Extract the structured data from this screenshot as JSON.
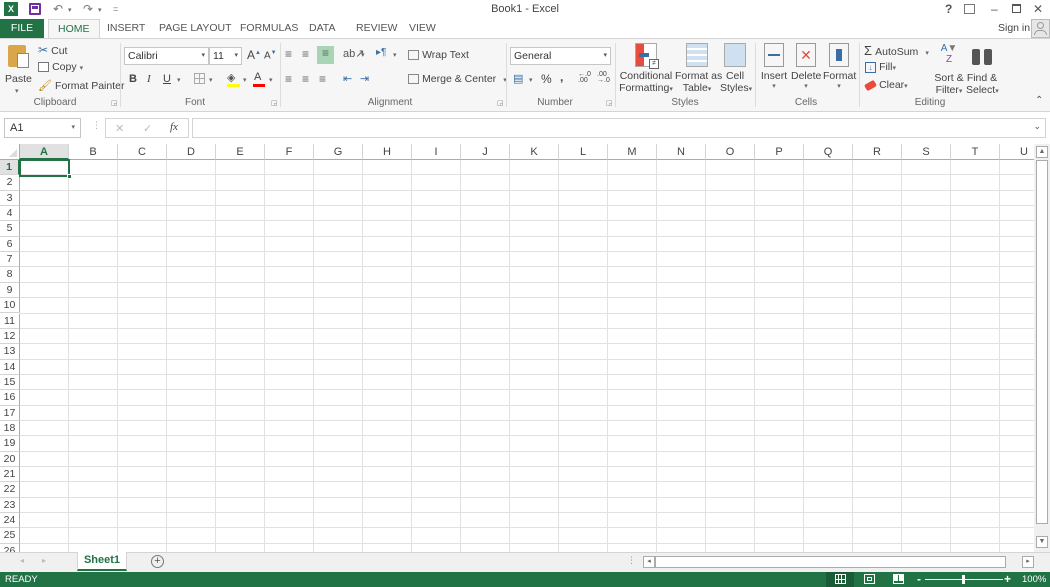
{
  "window": {
    "title": "Book1 - Excel",
    "help": "?",
    "ribbon_display": "⊡",
    "minimize": "–",
    "restore": "🗗",
    "close": "✕",
    "sign_in": "Sign in"
  },
  "qat": {
    "undo": "↶",
    "redo": "↷",
    "customize": "="
  },
  "tabs": [
    {
      "label": "FILE"
    },
    {
      "label": "HOME",
      "active": true
    },
    {
      "label": "INSERT"
    },
    {
      "label": "PAGE LAYOUT"
    },
    {
      "label": "FORMULAS"
    },
    {
      "label": "DATA"
    },
    {
      "label": "REVIEW"
    },
    {
      "label": "VIEW"
    }
  ],
  "ribbon": {
    "clipboard": {
      "label": "Clipboard",
      "paste": "Paste",
      "cut": "Cut",
      "copy": "Copy",
      "format_painter": "Format Painter"
    },
    "font": {
      "label": "Font",
      "font_name": "Calibri",
      "font_size": "11",
      "bold": "B",
      "italic": "I",
      "underline": "U",
      "grow": "A",
      "shrink": "A",
      "fill_color": "#ffff00",
      "font_color": "#ff0000"
    },
    "alignment": {
      "label": "Alignment",
      "wrap_text": "Wrap Text",
      "merge_center": "Merge & Center"
    },
    "number": {
      "label": "Number",
      "format": "General",
      "percent": "%",
      "comma": ",",
      "inc_decimal": "←.0 .00",
      "dec_decimal": ".00 →.0"
    },
    "styles": {
      "label": "Styles",
      "conditional_formatting": [
        "Conditional",
        "Formatting"
      ],
      "format_as_table": [
        "Format as",
        "Table"
      ],
      "cell_styles": [
        "Cell",
        "Styles"
      ]
    },
    "cells": {
      "label": "Cells",
      "insert": "Insert",
      "delete": "Delete",
      "format": "Format"
    },
    "editing": {
      "label": "Editing",
      "autosum": "AutoSum",
      "fill": "Fill",
      "clear": "Clear",
      "sort_filter": [
        "Sort &",
        "Filter"
      ],
      "find_select": [
        "Find &",
        "Select"
      ]
    }
  },
  "formula_bar": {
    "name_box": "A1",
    "cancel": "✕",
    "enter": "✓",
    "fx": "fx",
    "formula": ""
  },
  "grid": {
    "columns": [
      "A",
      "B",
      "C",
      "D",
      "E",
      "F",
      "G",
      "H",
      "I",
      "J",
      "K",
      "L",
      "M",
      "N",
      "O",
      "P",
      "Q",
      "R",
      "S",
      "T",
      "U"
    ],
    "rows": [
      "1",
      "2",
      "3",
      "4",
      "5",
      "6",
      "7",
      "8",
      "9",
      "10",
      "11",
      "12",
      "13",
      "14",
      "15",
      "16",
      "17",
      "18",
      "19",
      "20",
      "21",
      "22",
      "23",
      "24",
      "25",
      "26"
    ],
    "active_cell": "A1"
  },
  "sheets": [
    {
      "name": "Sheet1",
      "active": true
    }
  ],
  "new_sheet": "+",
  "status": {
    "text": "READY",
    "zoom": "100%",
    "zoom_out": "-",
    "zoom_in": "+",
    "zoom_level": 1.0
  },
  "colors": {
    "accent": "#217346"
  }
}
